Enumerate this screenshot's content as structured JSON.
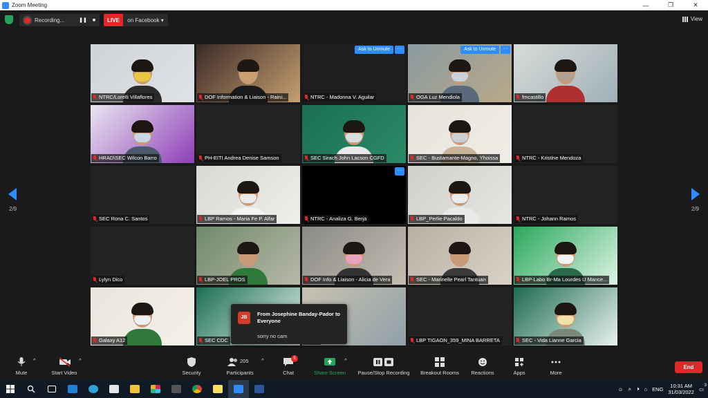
{
  "window": {
    "title": "Zoom Meeting",
    "controls": [
      "—",
      "❐",
      "✕"
    ]
  },
  "topbar": {
    "recording_label": "Recording...",
    "pause_glyph": "❚❚",
    "stop_glyph": "■",
    "live_label": "LIVE",
    "live_target": "on Facebook ▾",
    "view_label": "View"
  },
  "pages": {
    "left": "2/9",
    "right": "2/9"
  },
  "tiles": [
    {
      "name": "NTRC/Lorelli Villaflores"
    },
    {
      "name": "DOF Information & Liaison - Raini..."
    },
    {
      "name": "NTRC - Madonna V. Aguilar",
      "ask": "Ask to Unmute"
    },
    {
      "name": "OGA Luz Mendiola",
      "ask": "Ask to Unmute"
    },
    {
      "name": "fmcastillo"
    },
    {
      "name": "HRAD\\SEC Wilcon Barro"
    },
    {
      "name": "PH-EITI Andrea Denise Samson"
    },
    {
      "name": "SEC Sirach John Lacson CGFD"
    },
    {
      "name": "SEC - Bustamante-Magno, Yhoissa"
    },
    {
      "name": "NTRC - Kristine Mendoza"
    },
    {
      "name": "SEC Rona C. Santos"
    },
    {
      "name": "LBP Ramos - Maria Fe P. Alfar"
    },
    {
      "name": "NTRC - Analiza G. Berja"
    },
    {
      "name": "LBP_Perlie Pacaldo"
    },
    {
      "name": "NTRC - Johann Ramos"
    },
    {
      "name": "Lylyn Dico"
    },
    {
      "name": "LBP-JOEL PROS"
    },
    {
      "name": "DOF Info & Liaison - Alicia de Vera"
    },
    {
      "name": "SEC - Marinelle Pearl Tantuan"
    },
    {
      "name": "LBP-Labo Br-Ma Lourdes U Mance..."
    },
    {
      "name": "Galaxy A12"
    },
    {
      "name": "SEC CDC"
    },
    {
      "name": "...al"
    },
    {
      "name": "LBP TIGAON_359_MINA BARRETA"
    },
    {
      "name": "SEC - Vida Lianne Garcia"
    }
  ],
  "chat_popup": {
    "initials": "JB",
    "from": "From Josephine Banday-Pador to Everyone",
    "message": "sorry no cam"
  },
  "toolbar": {
    "mute": "Mute",
    "start_video": "Start Video",
    "security": "Security",
    "participants": "Participants",
    "participants_count": "205",
    "chat": "Chat",
    "chat_badge": "5",
    "share_screen": "Share Screen",
    "pause_stop_recording": "Pause/Stop Recording",
    "breakout_rooms": "Breakout Rooms",
    "reactions": "Reactions",
    "apps": "Apps",
    "more": "More",
    "end": "End"
  },
  "taskbar": {
    "language": "ENG",
    "time": "10:31 AM",
    "date": "31/03/2022",
    "notifications": "3"
  },
  "colors": {
    "accent": "#2d8cff",
    "danger": "#e02828",
    "share": "#22a55a"
  }
}
